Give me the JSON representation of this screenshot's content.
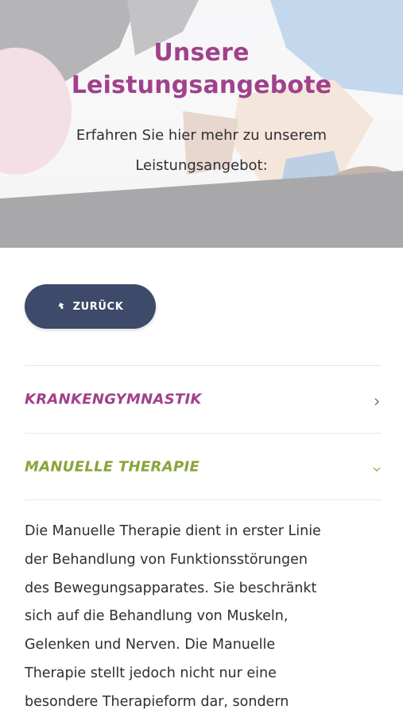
{
  "hero": {
    "title_line1": "Unsere",
    "title_line2": "Leistungsangebote",
    "subtitle_line1": "Erfahren Sie hier mehr zu unserem",
    "subtitle_line2": "Leistungsangebot:"
  },
  "back_button": {
    "label": "ZURÜCK",
    "icon": "back-arrow-icon"
  },
  "accordion": {
    "items": [
      {
        "title": "KRANKENGYMNASTIK",
        "expanded": false,
        "icon": "chevron-right-icon",
        "color": "#a0418c"
      },
      {
        "title": "MANUELLE THERAPIE",
        "expanded": true,
        "icon": "chevron-down-icon",
        "color": "#8aa43a"
      }
    ]
  },
  "content": {
    "lines": [
      "Die Manuelle Therapie dient in erster Linie",
      "der Behandlung von Funktionsstörungen",
      "des Bewegungsapparates. Sie beschränkt",
      "sich auf die Behandlung von Muskeln,",
      "Gelenken und Nerven. Die Manuelle",
      "Therapie stellt jedoch nicht nur eine",
      "besondere Therapieform dar, sondern"
    ]
  },
  "colors": {
    "title_purple": "#a0418c",
    "button_navy": "#3d4a69",
    "accent_green": "#8aa43a",
    "text_dark": "#2e2e33"
  }
}
